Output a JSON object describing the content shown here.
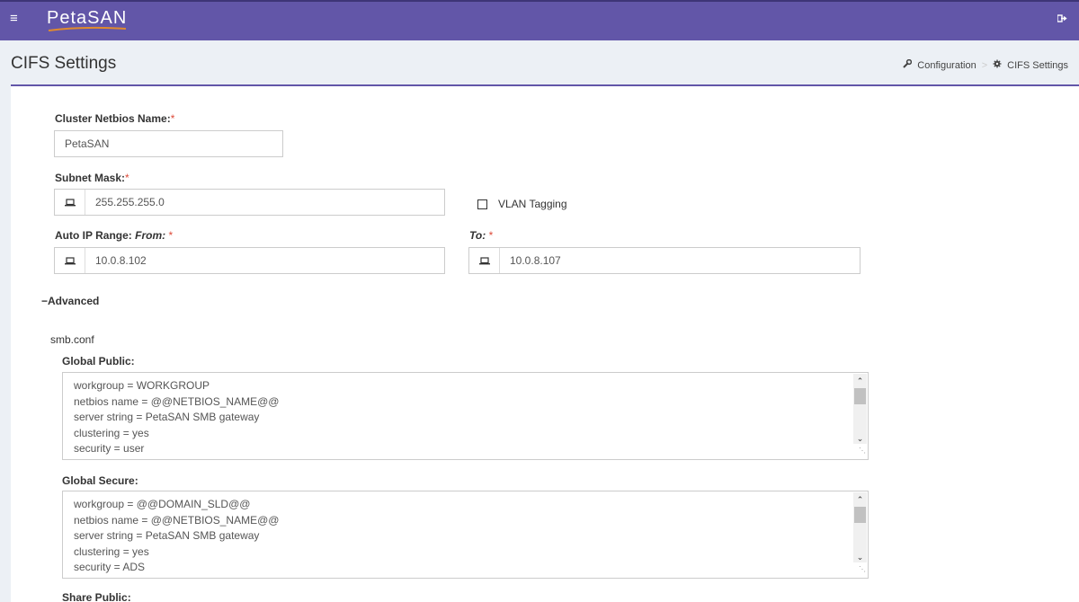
{
  "app": {
    "logo": "PetaSAN"
  },
  "header": {
    "title": "CIFS Settings"
  },
  "breadcrumb": {
    "configuration": "Configuration",
    "current": "CIFS Settings"
  },
  "form": {
    "netbios_label": "Cluster Netbios Name:",
    "netbios_value": "PetaSAN",
    "subnet_label": "Subnet Mask:",
    "subnet_value": "255.255.255.0",
    "vlan_label": "VLAN Tagging",
    "vlan_checked": false,
    "range_label": "Auto IP Range: ",
    "range_from": "From:",
    "range_from_value": "10.0.8.102",
    "range_to": "To:",
    "range_to_value": "10.0.8.107",
    "required_mark": "*"
  },
  "advanced": {
    "toggle_label": "Advanced",
    "smb_title": "smb.conf",
    "global_public_label": "Global Public:",
    "global_public_text": "workgroup = WORKGROUP\nnetbios name = @@NETBIOS_NAME@@\nserver string = PetaSAN SMB gateway\nclustering = yes\nsecurity = user",
    "global_secure_label": "Global Secure:",
    "global_secure_text": "workgroup = @@DOMAIN_SLD@@\nnetbios name = @@NETBIOS_NAME@@\nserver string = PetaSAN SMB gateway\nclustering = yes\nsecurity = ADS",
    "share_public_label": "Share Public:"
  },
  "icons": {
    "menu": "hamburger-icon",
    "logout": "sign-out-icon",
    "wrench": "wrench-icon",
    "gear": "gear-icon",
    "laptop": "laptop-icon"
  },
  "colors": {
    "topbar": "#6256a8",
    "required": "#dd4b39"
  }
}
